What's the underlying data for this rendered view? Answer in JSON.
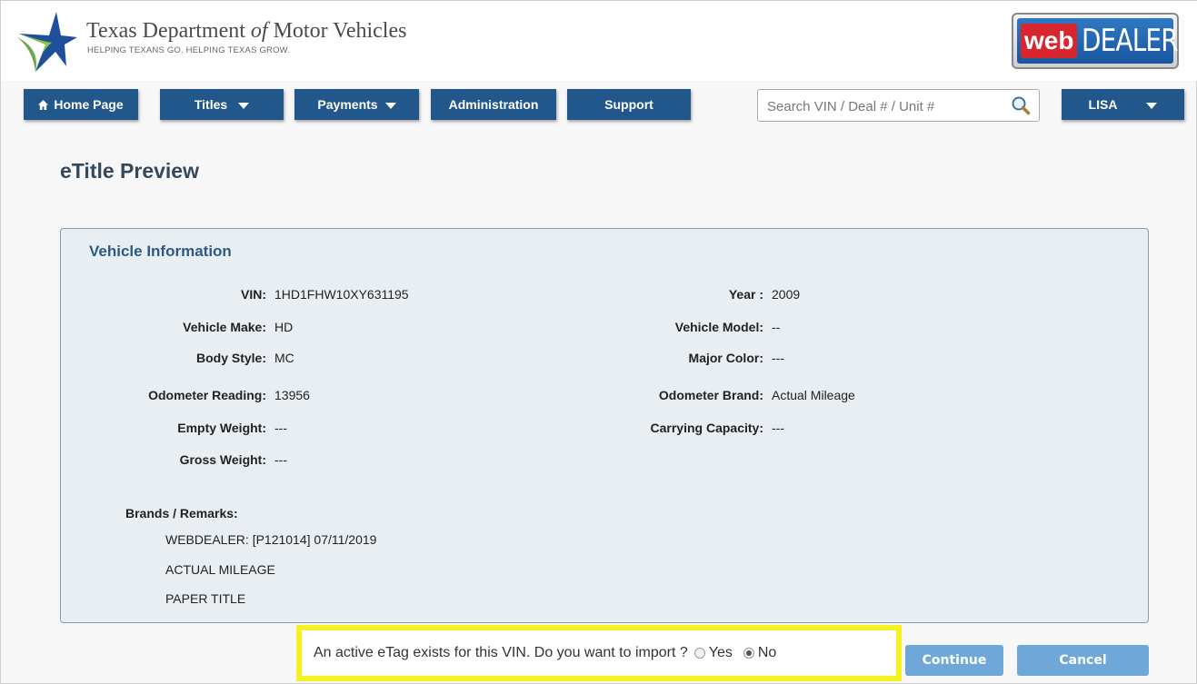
{
  "header": {
    "brand_name_part1": "Texas Department ",
    "brand_name_of": "of",
    "brand_name_part2": " Motor Vehicles",
    "tagline": "HELPING TEXANS GO. HELPING TEXAS GROW.",
    "webdealer_web": "web",
    "webdealer_dealer": "DEALER"
  },
  "nav": {
    "home_icon": "home-icon",
    "home": "Home Page",
    "titles": "Titles",
    "payments": "Payments",
    "administration": "Administration",
    "support": "Support",
    "user": "LISA"
  },
  "search": {
    "placeholder": "Search VIN / Deal # / Unit #"
  },
  "page": {
    "title": "eTitle Preview"
  },
  "vehicle": {
    "section_title": "Vehicle Information",
    "fields_left": [
      {
        "label": "VIN:",
        "value": "1HD1FHW10XY631195"
      },
      {
        "label": "Vehicle Make:",
        "value": "HD"
      },
      {
        "label": "Body Style:",
        "value": "MC"
      },
      {
        "label": "Odometer Reading:",
        "value": "13956"
      },
      {
        "label": "Empty Weight:",
        "value": "---"
      },
      {
        "label": "Gross Weight:",
        "value": "---"
      }
    ],
    "fields_right": [
      {
        "label": "Year :",
        "value": "2009"
      },
      {
        "label": "Vehicle Model:",
        "value": "--"
      },
      {
        "label": "Major Color:",
        "value": "---"
      },
      {
        "label": "Odometer Brand:",
        "value": "Actual Mileage"
      },
      {
        "label": "Carrying Capacity:",
        "value": "---"
      }
    ],
    "brands_label": "Brands / Remarks:",
    "remarks": [
      "WEBDEALER: [P121014] 07/11/2019",
      "ACTUAL MILEAGE",
      "PAPER TITLE"
    ]
  },
  "etag_prompt": {
    "question": "An active eTag exists for this VIN. Do you want to import ?",
    "yes": "Yes",
    "no": "No",
    "selected": "No"
  },
  "actions": {
    "continue": "Continue",
    "cancel": "Cancel"
  },
  "colors": {
    "nav": "#22578b",
    "action_button": "#6fa8d8",
    "highlight": "#f5f222",
    "panel_bg": "#e9eef3",
    "section_title": "#2b5a86"
  }
}
